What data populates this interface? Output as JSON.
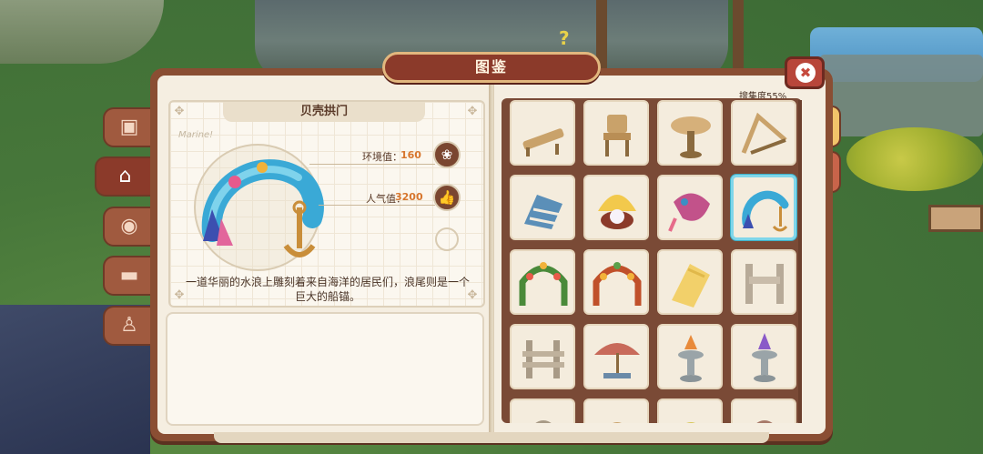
{
  "header": {
    "title": "图鉴",
    "close_icon": "close-icon"
  },
  "collection": {
    "label": "搜集度55%"
  },
  "left_tabs": [
    {
      "name": "box-icon",
      "glyph": "▣",
      "active": false
    },
    {
      "name": "house-icon",
      "glyph": "⌂",
      "active": true
    },
    {
      "name": "owl-icon",
      "glyph": "◉",
      "active": false
    },
    {
      "name": "sofa-icon",
      "glyph": "▬",
      "active": false
    },
    {
      "name": "shirt-icon",
      "glyph": "♙",
      "active": false
    }
  ],
  "right_tabs": [
    {
      "name": "house-tab-icon",
      "glyph": "⌂"
    },
    {
      "name": "beach-umbrella-icon",
      "glyph": "☂"
    }
  ],
  "item": {
    "name": "贝壳拱门",
    "environment_label": "环境值：",
    "environment_value": "160",
    "popularity_label": "人气值：",
    "popularity_value": "3200",
    "signature": "Marine!",
    "description": "一道华丽的水浪上雕刻着来自海洋的居民们，浪尾则是一个巨大的船锚。"
  },
  "grid": {
    "items": [
      {
        "name": "lounge-chair"
      },
      {
        "name": "wooden-chair"
      },
      {
        "name": "round-table"
      },
      {
        "name": "wooden-frame"
      },
      {
        "name": "striped-deck-chair"
      },
      {
        "name": "pearl-shell"
      },
      {
        "name": "coral-ornament"
      },
      {
        "name": "shell-arch",
        "selected": true
      },
      {
        "name": "flower-arch-green"
      },
      {
        "name": "flower-arch-red"
      },
      {
        "name": "yellow-sunbed"
      },
      {
        "name": "wooden-fence"
      },
      {
        "name": "wooden-post-fence"
      },
      {
        "name": "beach-umbrella"
      },
      {
        "name": "fountain-carrot"
      },
      {
        "name": "fountain-purple"
      },
      {
        "name": "partial-item-1"
      },
      {
        "name": "partial-item-2"
      },
      {
        "name": "partial-item-3"
      },
      {
        "name": "partial-item-4"
      }
    ]
  }
}
